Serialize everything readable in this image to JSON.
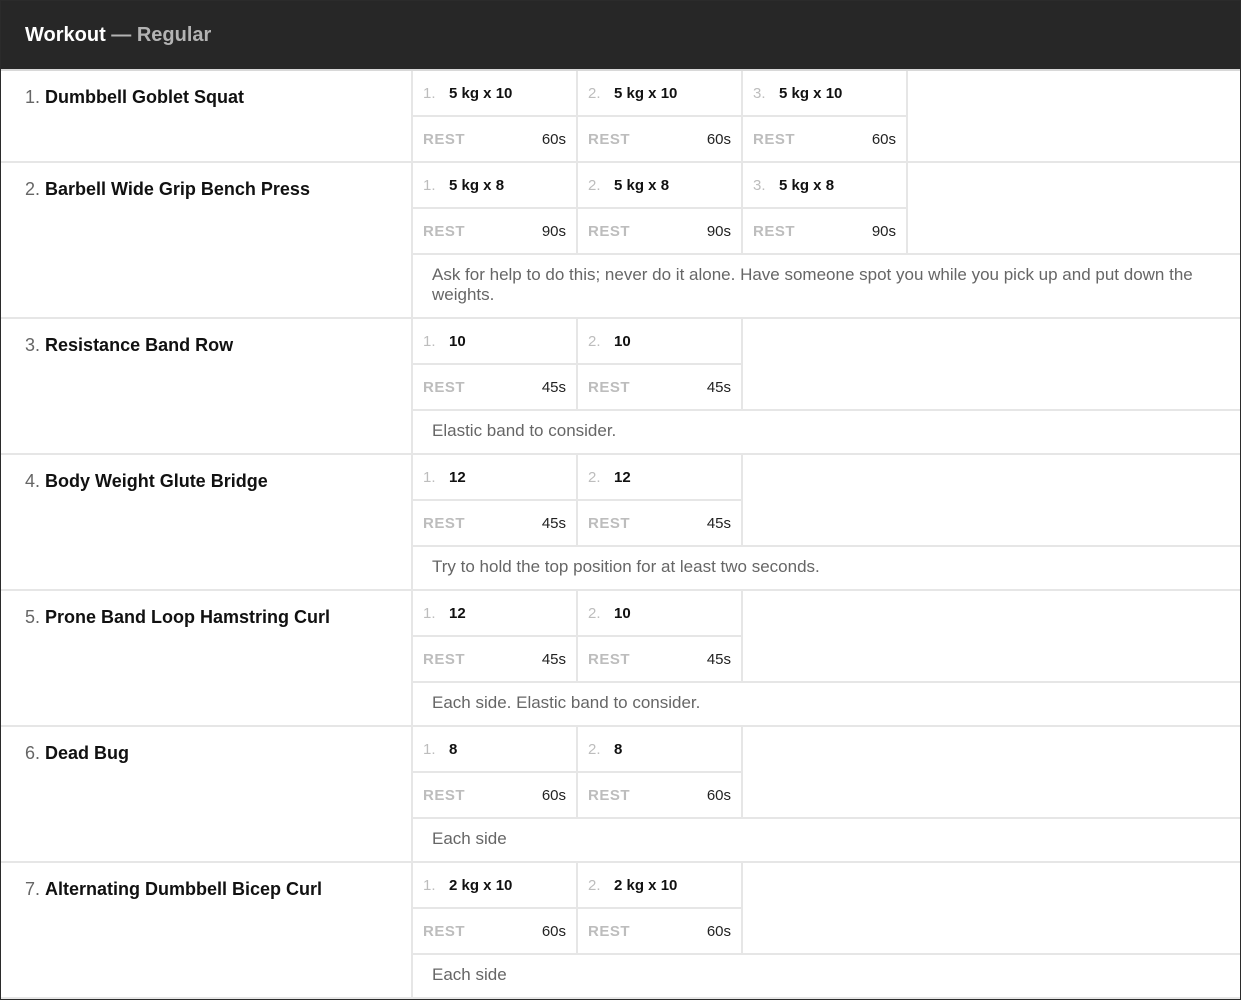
{
  "header": {
    "title": "Workout",
    "separator": " — ",
    "subtitle": "Regular"
  },
  "exercises": [
    {
      "num": "1.",
      "name": "Dumbbell Goblet Squat",
      "rest_label": "REST",
      "sets": [
        {
          "idx": "1.",
          "value": "5 kg x 10",
          "rest": "60s"
        },
        {
          "idx": "2.",
          "value": "5 kg x 10",
          "rest": "60s"
        },
        {
          "idx": "3.",
          "value": "5 kg x 10",
          "rest": "60s"
        }
      ],
      "note": ""
    },
    {
      "num": "2.",
      "name": "Barbell Wide Grip Bench Press",
      "rest_label": "REST",
      "sets": [
        {
          "idx": "1.",
          "value": "5 kg x 8",
          "rest": "90s"
        },
        {
          "idx": "2.",
          "value": "5 kg x 8",
          "rest": "90s"
        },
        {
          "idx": "3.",
          "value": "5 kg x 8",
          "rest": "90s"
        }
      ],
      "note": "Ask for help to do this; never do it alone. Have someone spot you while you pick up and put down the weights."
    },
    {
      "num": "3.",
      "name": "Resistance Band Row",
      "rest_label": "REST",
      "sets": [
        {
          "idx": "1.",
          "value": "10",
          "rest": "45s"
        },
        {
          "idx": "2.",
          "value": "10",
          "rest": "45s"
        }
      ],
      "note": "Elastic band to consider."
    },
    {
      "num": "4.",
      "name": "Body Weight Glute Bridge",
      "rest_label": "REST",
      "sets": [
        {
          "idx": "1.",
          "value": "12",
          "rest": "45s"
        },
        {
          "idx": "2.",
          "value": "12",
          "rest": "45s"
        }
      ],
      "note": "Try to hold the top position for at least two seconds."
    },
    {
      "num": "5.",
      "name": "Prone Band Loop Hamstring Curl",
      "rest_label": "REST",
      "sets": [
        {
          "idx": "1.",
          "value": "12",
          "rest": "45s"
        },
        {
          "idx": "2.",
          "value": "10",
          "rest": "45s"
        }
      ],
      "note": "Each side. Elastic band to consider."
    },
    {
      "num": "6.",
      "name": "Dead Bug",
      "rest_label": "REST",
      "sets": [
        {
          "idx": "1.",
          "value": "8",
          "rest": "60s"
        },
        {
          "idx": "2.",
          "value": "8",
          "rest": "60s"
        }
      ],
      "note": "Each side"
    },
    {
      "num": "7.",
      "name": "Alternating Dumbbell Bicep Curl",
      "rest_label": "REST",
      "sets": [
        {
          "idx": "1.",
          "value": "2 kg x 10",
          "rest": "60s"
        },
        {
          "idx": "2.",
          "value": "2 kg x 10",
          "rest": "60s"
        }
      ],
      "note": "Each side"
    }
  ]
}
